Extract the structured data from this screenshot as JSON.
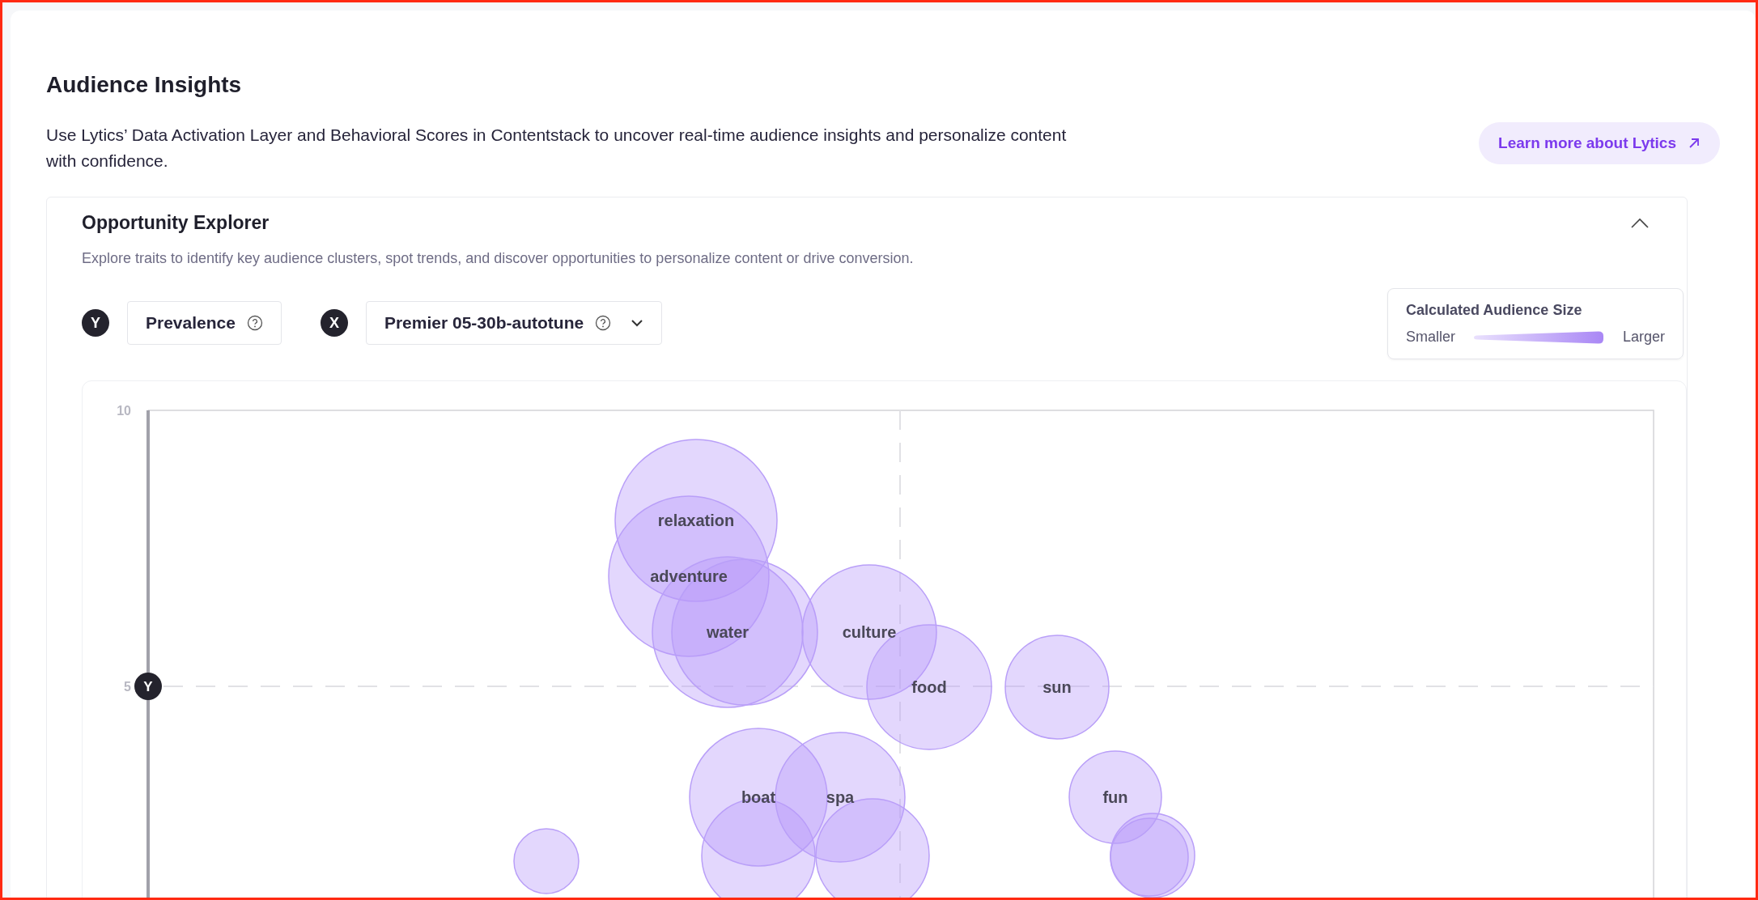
{
  "page": {
    "title": "Audience Insights",
    "description": "Use Lytics’ Data Activation Layer and Behavioral Scores in Contentstack to uncover real-time audience insights and personalize content with confidence.",
    "learn_more_button": {
      "label": "Learn more about Lytics"
    }
  },
  "explorer": {
    "title": "Opportunity Explorer",
    "expanded": true,
    "description": "Explore traits to identify key audience clusters, spot trends, and discover opportunities to personalize content or drive conversion.",
    "y_axis": {
      "badge": "Y",
      "label": "Prevalence"
    },
    "x_axis": {
      "badge": "X",
      "label": "Premier 05-30b-autotune"
    },
    "legend": {
      "title": "Calculated Audience Size",
      "min_label": "Smaller",
      "max_label": "Larger"
    },
    "chart": {
      "y_ticks": [
        "10",
        "5"
      ],
      "y_marker": "Y",
      "bubbles": [
        {
          "label": "relaxation"
        },
        {
          "label": "adventure"
        },
        {
          "label": "water"
        },
        {
          "label": "culture"
        },
        {
          "label": "food"
        },
        {
          "label": "sun"
        },
        {
          "label": "boat"
        },
        {
          "label": "spa"
        },
        {
          "label": "fun"
        }
      ]
    }
  }
}
